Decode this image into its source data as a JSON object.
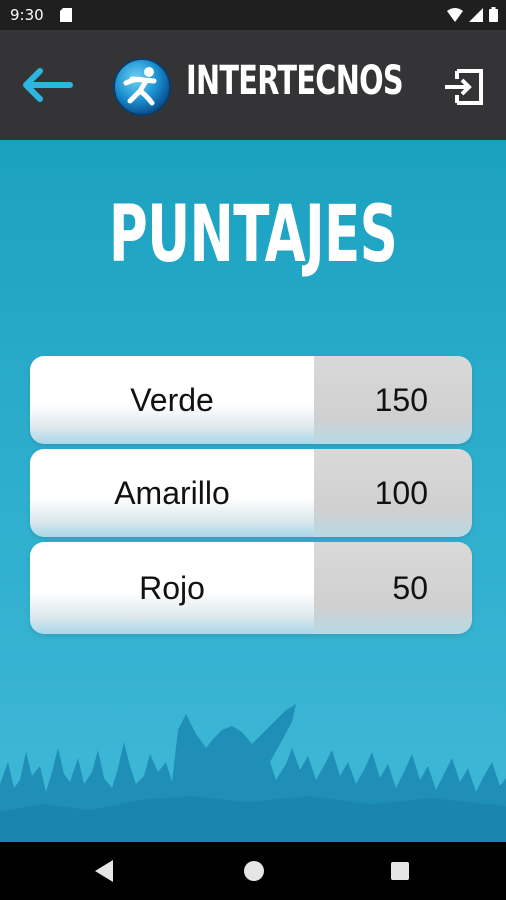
{
  "status_bar": {
    "time": "9:30"
  },
  "app_bar": {
    "brand": "INTERTECNOS"
  },
  "page": {
    "title": "PUNTAJES"
  },
  "scores": [
    {
      "name": "Verde",
      "points": "150"
    },
    {
      "name": "Amarillo",
      "points": "100"
    },
    {
      "name": "Rojo",
      "points": "50"
    }
  ],
  "icons": {
    "back": "arrow-left-icon",
    "exit": "exit-icon",
    "logo": "runner-logo-icon"
  },
  "colors": {
    "accent": "#2bb8e0",
    "app_bar": "#343436",
    "background": "#2dadcc",
    "crowd": "#1f8fb8"
  }
}
